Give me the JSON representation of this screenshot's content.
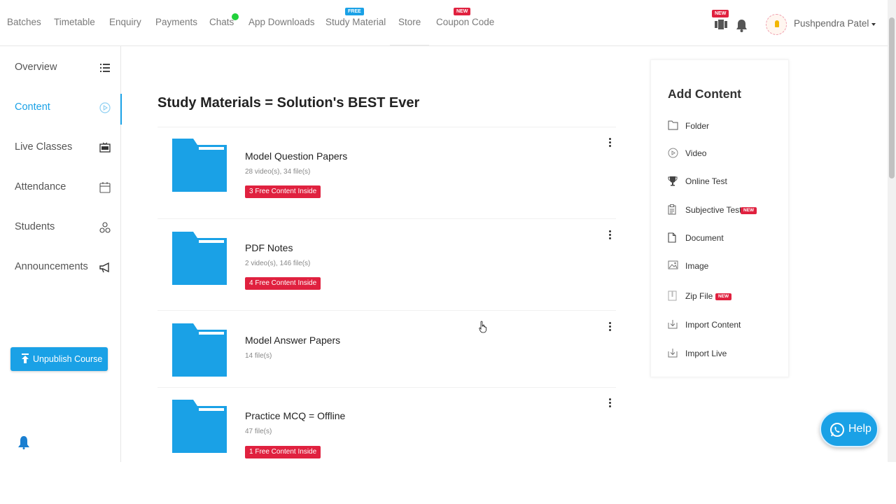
{
  "topnav": {
    "items": [
      {
        "label": "Batches"
      },
      {
        "label": "Timetable"
      },
      {
        "label": "Enquiry"
      },
      {
        "label": "Payments"
      },
      {
        "label": "Chats"
      },
      {
        "label": "App Downloads"
      },
      {
        "label": "Study Material",
        "badge": "FREE"
      },
      {
        "label": "Store"
      },
      {
        "label": "Coupon Code",
        "badge": "NEW"
      }
    ],
    "chats_status_color": "#22d13b",
    "app_icon_badge": "NEW",
    "user_name": "Pushpendra Patel"
  },
  "sidebar": {
    "items": [
      {
        "label": "Overview",
        "icon": "list-icon"
      },
      {
        "label": "Content",
        "icon": "play-circle-icon",
        "active": true
      },
      {
        "label": "Live Classes",
        "icon": "rec-icon"
      },
      {
        "label": "Attendance",
        "icon": "calendar-icon"
      },
      {
        "label": "Students",
        "icon": "students-icon"
      },
      {
        "label": "Announcements",
        "icon": "megaphone-icon"
      }
    ],
    "unpublish_label": "Unpublish Course"
  },
  "main": {
    "title": "Study Materials = Solution's BEST Ever",
    "folders": [
      {
        "name": "Model Question Papers",
        "meta": "28 video(s), 34 file(s)",
        "free": "3 Free Content Inside"
      },
      {
        "name": "PDF Notes",
        "meta": "2 video(s), 146 file(s)",
        "free": "4 Free Content Inside"
      },
      {
        "name": "Model Answer Papers",
        "meta": "14 file(s)",
        "free": ""
      },
      {
        "name": "Practice MCQ = Offline",
        "meta": "47 file(s)",
        "free": "1 Free Content Inside"
      }
    ]
  },
  "add_content": {
    "title": "Add Content",
    "items": [
      {
        "label": "Folder",
        "icon": "folder-outline-icon"
      },
      {
        "label": "Video",
        "icon": "play-circle-icon"
      },
      {
        "label": "Online Test",
        "icon": "trophy-icon"
      },
      {
        "label": "Subjective Test",
        "icon": "clipboard-icon",
        "badge": "NEW"
      },
      {
        "label": "Document",
        "icon": "document-icon"
      },
      {
        "label": "Image",
        "icon": "image-icon"
      },
      {
        "label": "Zip File",
        "icon": "zip-icon",
        "badge": "NEW"
      },
      {
        "label": "Import Content",
        "icon": "import-icon"
      },
      {
        "label": "Import Live",
        "icon": "import-icon"
      }
    ]
  },
  "help": {
    "label": "Help"
  },
  "colors": {
    "accent": "#1aa1e6",
    "badge_red": "#e0213f",
    "folder_blue": "#1aa1e6"
  }
}
